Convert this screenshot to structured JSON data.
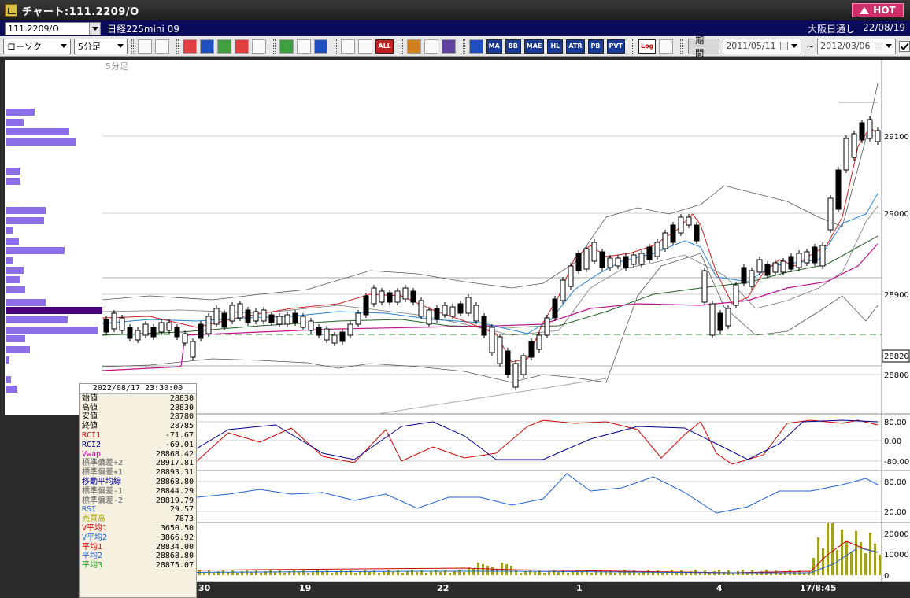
{
  "window": {
    "title": "チャート:111.2209/O",
    "hot_label": "HOT"
  },
  "info": {
    "symbol": "111.2209/O",
    "name": "日経225mini 09",
    "session": "大阪日通し",
    "date": "22/08/19"
  },
  "toolbar": {
    "chart_type": "ローソク",
    "interval": "5分足",
    "indicator_buttons": [
      "MA",
      "BB",
      "MAE",
      "HL",
      "ATR",
      "PB",
      "PVT"
    ],
    "log_label": "Log",
    "all_label": "ALL",
    "period_label": "期間",
    "date_from": "2011/05/11",
    "date_to": "2012/03/06",
    "tilde": "~"
  },
  "chart": {
    "interval_label": "5分足",
    "price_ticks": [
      "29100",
      "29000",
      "28900",
      "28800"
    ],
    "current_price": "28820",
    "rci_ticks": [
      "80.00",
      "0.00",
      "-80.00"
    ],
    "rsi_ticks": [
      "80.00",
      "20.00"
    ],
    "volume_ticks": [
      "20000",
      "10000",
      "0"
    ],
    "x_labels": [
      "30",
      "19",
      "22",
      "1",
      "4",
      "17/8:45"
    ]
  },
  "data_panel": {
    "timestamp": "2022/08/17 23:30:00",
    "rows": [
      {
        "label": "始値",
        "value": "28830",
        "color": "#000000"
      },
      {
        "label": "高値",
        "value": "28830",
        "color": "#000000"
      },
      {
        "label": "安値",
        "value": "28780",
        "color": "#000000"
      },
      {
        "label": "終値",
        "value": "28785",
        "color": "#000000"
      },
      {
        "label": "RCI1",
        "value": "-71.67",
        "color": "#d00000"
      },
      {
        "label": "RCI2",
        "value": "-69.01",
        "color": "#000090"
      },
      {
        "label": "Vwap",
        "value": "28868.42",
        "color": "#c000a0"
      },
      {
        "label": "標準偏差+2",
        "value": "28917.81",
        "color": "#606060"
      },
      {
        "label": "標準偏差+1",
        "value": "28893.31",
        "color": "#606060"
      },
      {
        "label": "移動平均線",
        "value": "28868.80",
        "color": "#000090"
      },
      {
        "label": "標準偏差-1",
        "value": "28844.29",
        "color": "#606060"
      },
      {
        "label": "標準偏差-2",
        "value": "28819.79",
        "color": "#606060"
      },
      {
        "label": "RSI",
        "value": "29.57",
        "color": "#2060d0"
      },
      {
        "label": "売買高",
        "value": "7873",
        "color": "#a0a000"
      },
      {
        "label": "V平均1",
        "value": "3650.50",
        "color": "#d00000"
      },
      {
        "label": "V平均2",
        "value": "3866.92",
        "color": "#2060d0"
      },
      {
        "label": "平均1",
        "value": "28834.00",
        "color": "#d00000"
      },
      {
        "label": "平均2",
        "value": "28868.80",
        "color": "#2060d0"
      },
      {
        "label": "平均3",
        "value": "28875.07",
        "color": "#20a020"
      }
    ]
  },
  "colors": {
    "title_bg": "#1e1e1e",
    "info_bg": "#0b0b5c",
    "vol_profile": "#8c6ee8",
    "vol_current": "#4b007f"
  }
}
